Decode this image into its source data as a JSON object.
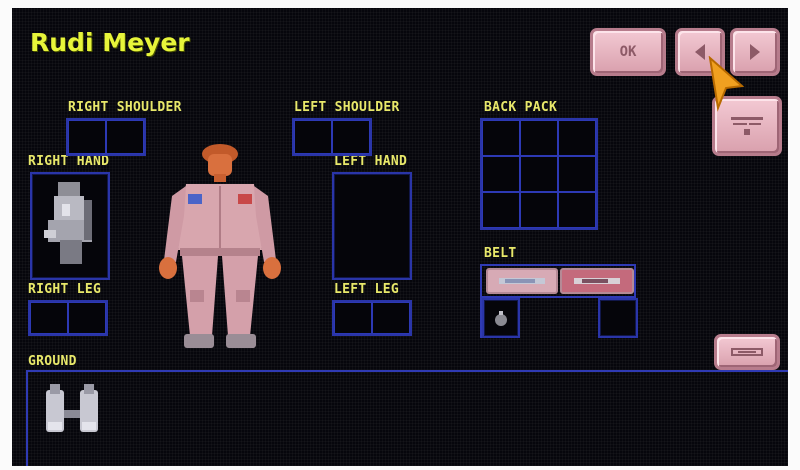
{
  "character": {
    "name": "Rudi Meyer"
  },
  "buttons": {
    "ok_label": "OK"
  },
  "slots": {
    "right_shoulder": "RIGHT SHOULDER",
    "left_shoulder": "LEFT SHOULDER",
    "back_pack": "BACK PACK",
    "right_hand": "RIGHT HAND",
    "left_hand": "LEFT HAND",
    "belt": "BELT",
    "right_leg": "RIGHT LEG",
    "left_leg": "LEFT LEG",
    "ground": "GROUND"
  },
  "icons": {
    "prev": "left-arrow-icon",
    "next": "right-arrow-icon",
    "stats": "stats-icon",
    "scroll": "scroll-icon",
    "cursor": "arrow-cursor-icon"
  },
  "colors": {
    "label": "#e8e86a",
    "title": "#e7f53a",
    "grid": "#2a35a8",
    "button": "#e8b6c2"
  }
}
